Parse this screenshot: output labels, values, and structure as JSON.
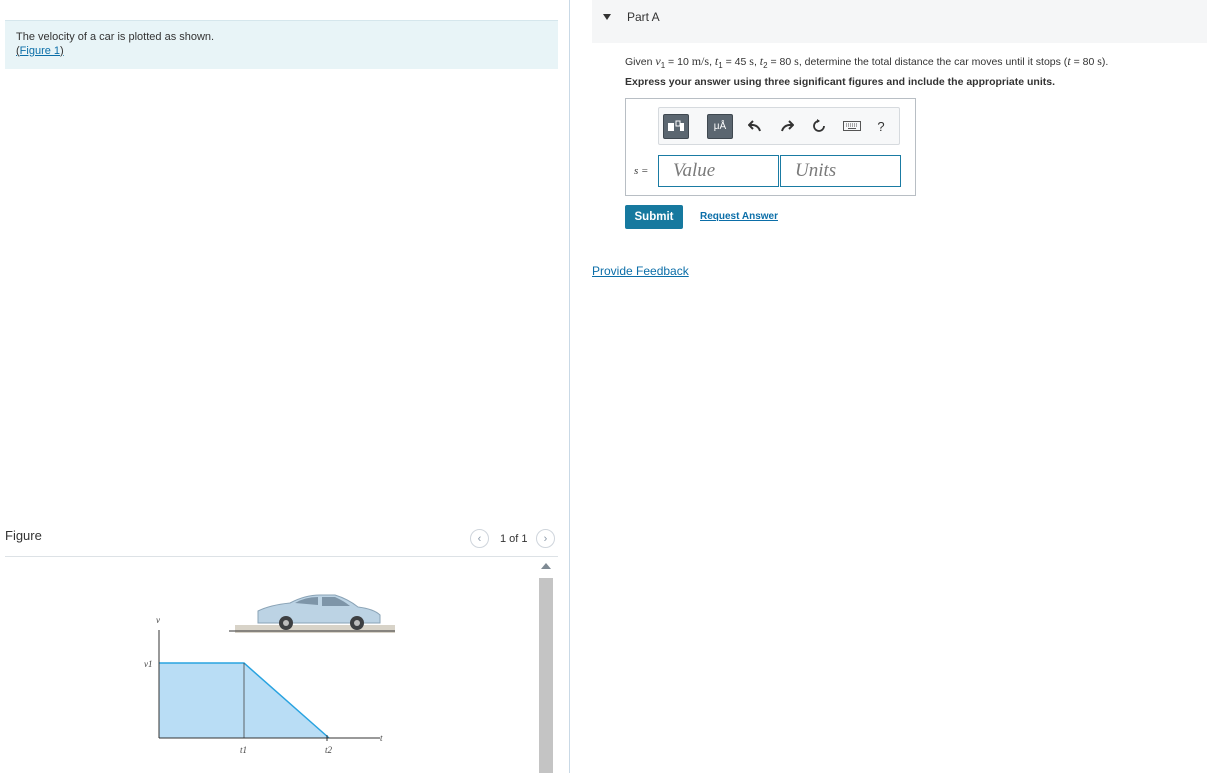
{
  "intro": {
    "text": "The velocity of a car is plotted as shown.",
    "figure_link": "Figure 1"
  },
  "figure": {
    "title": "Figure",
    "counter": "1 of 1",
    "prev_icon": "chevron-left-icon",
    "next_icon": "chevron-right-icon",
    "graph": {
      "y_axis_label": "v",
      "v1_label": "v1",
      "t1_label": "t1",
      "t2_label": "t2",
      "x_axis_label": "t"
    }
  },
  "part": {
    "title": "Part A",
    "question": {
      "given": "Given ",
      "v1_sym": "v",
      "v1_sub": "1",
      "v1_val": " = 10 ",
      "v1_unit": "m/s",
      "t1_sym": "t",
      "t1_sub": "1",
      "t1_val": " = 45 ",
      "t1_unit": "s",
      "t2_sym": "t",
      "t2_sub": "2",
      "t2_val": " = 80 ",
      "t2_unit": "s",
      "rest": ", determine the total distance the car moves until it stops (",
      "t_sym": "t",
      "t_val": " = 80 ",
      "t_unit": "s",
      "end": ")."
    },
    "instruction": "Express your answer using three significant figures and include the appropriate units.",
    "toolbar": {
      "templates_icon": "templates-icon",
      "units_label": "μÅ",
      "undo_icon": "undo-icon",
      "redo_icon": "redo-icon",
      "reset_icon": "reset-icon",
      "keyboard_icon": "keyboard-icon",
      "help_label": "?"
    },
    "answer_label": "s =",
    "value_placeholder": "Value",
    "units_placeholder": "Units",
    "submit_label": "Submit",
    "request_label": "Request Answer"
  },
  "feedback_label": "Provide Feedback",
  "colors": {
    "accent": "#16799f",
    "link": "#0b6ea8",
    "intro_bg": "#e8f4f7",
    "graph_fill": "#b9ddf5",
    "graph_line": "#29a3e0"
  }
}
